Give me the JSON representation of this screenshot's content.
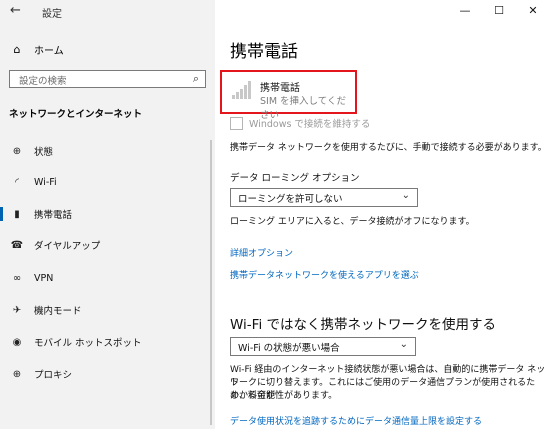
{
  "window": {
    "title": "設定"
  },
  "sidebar": {
    "home_label": "ホーム",
    "search_placeholder": "設定の検索",
    "section_title": "ネットワークとインターネット",
    "items": [
      {
        "label": "状態",
        "icon": "globe-icon"
      },
      {
        "label": "Wi-Fi",
        "icon": "wifi-icon"
      },
      {
        "label": "携帯電話",
        "icon": "cellular-icon",
        "active": true
      },
      {
        "label": "ダイヤルアップ",
        "icon": "phone-icon"
      },
      {
        "label": "VPN",
        "icon": "vpn-icon"
      },
      {
        "label": "機内モード",
        "icon": "airplane-icon"
      },
      {
        "label": "モバイル ホットスポット",
        "icon": "hotspot-icon"
      },
      {
        "label": "プロキシ",
        "icon": "globe-icon"
      }
    ]
  },
  "main": {
    "title": "携帯電話",
    "status": {
      "name": "携帯電話",
      "subtitle": "SIM を挿入してください"
    },
    "windows_connect_label": "Windows で接続を維持する",
    "desc1": "携帯データ ネットワークを使用するたびに、手動で接続する必要があります。",
    "roaming_label": "データ ローミング オプション",
    "roaming_value": "ローミングを許可しない",
    "roaming_desc": "ローミング エリアに入ると、データ接続がオフになります。",
    "link_advanced": "詳細オプション",
    "link_apps": "携帯データネットワークを使えるアプリを選ぶ",
    "wifi_heading": "Wi-Fi ではなく携帯ネットワークを使用する",
    "wifi_value": "Wi-Fi の状態が悪い場合",
    "wifi_desc1": "Wi-Fi 経由のインターネット接続状態が悪い場合は、自動的に携帯データ ネット",
    "wifi_desc2": "ワークに切り替えます。これにはご使用のデータ通信プランが使用されるため、料金が",
    "wifi_desc3": "かかる可能性があります。",
    "link_limit": "データ使用状況を追跡するためにデータ通信量上限を設定する"
  },
  "colors": {
    "accent": "#0063b1",
    "link": "#0067c0",
    "highlight": "#e3161e"
  }
}
